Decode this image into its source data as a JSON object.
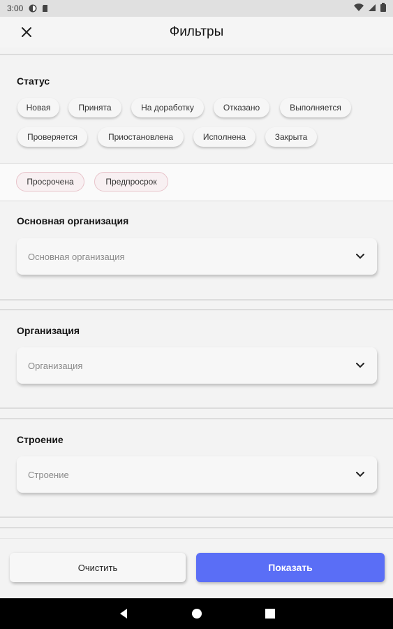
{
  "status_bar": {
    "time": "3:00"
  },
  "app_bar": {
    "title": "Фильтры",
    "close_icon": "close-icon"
  },
  "status_section": {
    "title": "Статус",
    "chips_row1": [
      "Новая",
      "Принята",
      "На доработку",
      "Отказано",
      "Выполняется"
    ],
    "chips_row2": [
      "Проверяется",
      "Приостановлена",
      "Исполнена",
      "Закрыта"
    ],
    "deadline_chips": [
      "Просрочена",
      "Предпросрок"
    ]
  },
  "main_org": {
    "title": "Основная организация",
    "placeholder": "Основная организация"
  },
  "org": {
    "title": "Организация",
    "placeholder": "Организация"
  },
  "building": {
    "title": "Строение",
    "placeholder": "Строение"
  },
  "footer": {
    "clear_label": "Очистить",
    "show_label": "Показать"
  },
  "colors": {
    "accent": "#5a6ef6",
    "deadline_chip_border": "#e8c4cb"
  }
}
